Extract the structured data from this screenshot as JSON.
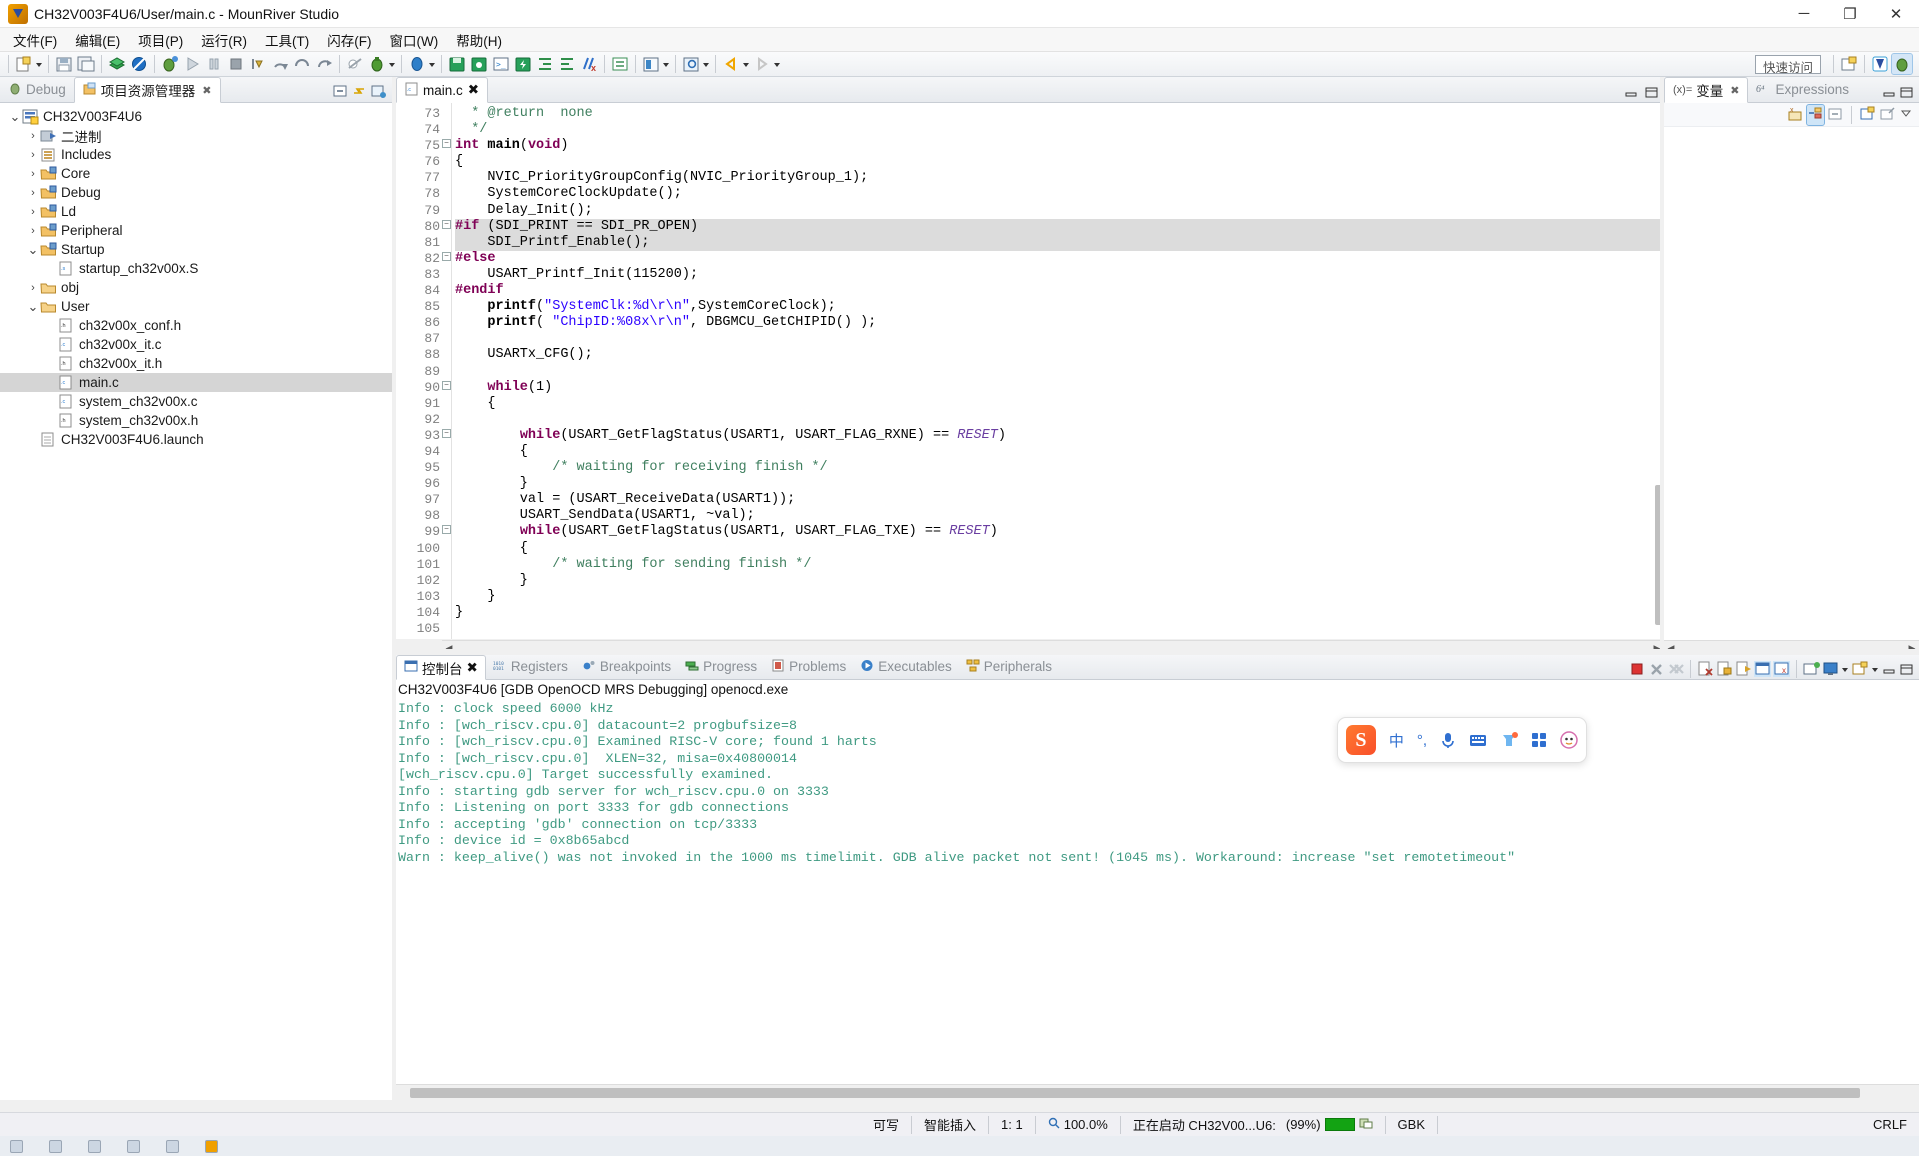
{
  "window": {
    "title": "CH32V003F4U6/User/main.c - MounRiver Studio",
    "app_icon": "mounriver-logo-icon",
    "minimize": "─",
    "maximize": "❐",
    "close": "✕"
  },
  "menubar": {
    "items": [
      {
        "label": "文件(F)",
        "name": "menu-file"
      },
      {
        "label": "编辑(E)",
        "name": "menu-edit"
      },
      {
        "label": "项目(P)",
        "name": "menu-project"
      },
      {
        "label": "运行(R)",
        "name": "menu-run"
      },
      {
        "label": "工具(T)",
        "name": "menu-tools"
      },
      {
        "label": "闪存(F)",
        "name": "menu-flash"
      },
      {
        "label": "窗口(W)",
        "name": "menu-window"
      },
      {
        "label": "帮助(H)",
        "name": "menu-help"
      }
    ]
  },
  "toolbar": {
    "quick_access": "快速访问",
    "perspective_icons": [
      "new-perspective-icon",
      "mounriver-perspective-icon",
      "debug-perspective-icon"
    ]
  },
  "left_panel": {
    "tabs": [
      {
        "label": "Debug",
        "name": "view-tab-debug",
        "active": false,
        "icon": "bug-icon"
      },
      {
        "label": "项目资源管理器",
        "name": "view-tab-project-explorer",
        "active": true,
        "icon": "project-explorer-icon",
        "close": "✖"
      }
    ],
    "toolbar_icons": [
      "collapse-all-icon",
      "link-with-editor-icon",
      "view-menu-icon"
    ],
    "tree": [
      {
        "label": "CH32V003F4U6",
        "indent": 0,
        "twist": "v",
        "icon": "project-icon",
        "selected": false
      },
      {
        "label": "二进制",
        "indent": 1,
        "twist": ">",
        "icon": "binaries-icon",
        "selected": false
      },
      {
        "label": "Includes",
        "indent": 1,
        "twist": ">",
        "icon": "includes-icon",
        "selected": false
      },
      {
        "label": "Core",
        "indent": 1,
        "twist": ">",
        "icon": "source-folder-icon",
        "selected": false
      },
      {
        "label": "Debug",
        "indent": 1,
        "twist": ">",
        "icon": "source-folder-icon",
        "selected": false
      },
      {
        "label": "Ld",
        "indent": 1,
        "twist": ">",
        "icon": "source-folder-icon",
        "selected": false
      },
      {
        "label": "Peripheral",
        "indent": 1,
        "twist": ">",
        "icon": "source-folder-icon",
        "selected": false
      },
      {
        "label": "Startup",
        "indent": 1,
        "twist": "v",
        "icon": "source-folder-icon",
        "selected": false
      },
      {
        "label": "startup_ch32v00x.S",
        "indent": 2,
        "twist": "",
        "icon": "asm-file-icon",
        "tag": ".s",
        "selected": false
      },
      {
        "label": "obj",
        "indent": 1,
        "twist": ">",
        "icon": "folder-icon",
        "selected": false
      },
      {
        "label": "User",
        "indent": 1,
        "twist": "v",
        "icon": "folder-icon",
        "selected": false
      },
      {
        "label": "ch32v00x_conf.h",
        "indent": 2,
        "twist": "",
        "icon": "header-file-icon",
        "tag": ".h",
        "selected": false
      },
      {
        "label": "ch32v00x_it.c",
        "indent": 2,
        "twist": "",
        "icon": "c-file-icon",
        "tag": ".c",
        "selected": false
      },
      {
        "label": "ch32v00x_it.h",
        "indent": 2,
        "twist": "",
        "icon": "header-file-icon",
        "tag": ".h",
        "selected": false
      },
      {
        "label": "main.c",
        "indent": 2,
        "twist": "",
        "icon": "c-file-icon",
        "tag": ".c",
        "selected": true
      },
      {
        "label": "system_ch32v00x.c",
        "indent": 2,
        "twist": "",
        "icon": "c-file-icon",
        "tag": ".c",
        "selected": false
      },
      {
        "label": "system_ch32v00x.h",
        "indent": 2,
        "twist": "",
        "icon": "header-file-icon",
        "tag": ".h",
        "selected": false
      },
      {
        "label": "CH32V003F4U6.launch",
        "indent": 1,
        "twist": "",
        "icon": "launch-file-icon",
        "selected": false
      }
    ]
  },
  "editor": {
    "tab": {
      "label": "main.c",
      "icon": "c-file-icon",
      "close": "✖"
    },
    "toolbar_icons": [
      "minimize-icon",
      "maximize-icon"
    ],
    "first_line": 73,
    "lines": [
      {
        "n": 73,
        "fold": "",
        "html": "  <span class=\"cm\">* @return  none</span>"
      },
      {
        "n": 74,
        "fold": "",
        "html": "  <span class=\"cm\">*/</span>"
      },
      {
        "n": 75,
        "fold": "-",
        "html": "<span class=\"kw\">int</span> <span class=\"fn\" style=\"font-weight:bold\">main</span>(<span class=\"kw\">void</span>)"
      },
      {
        "n": 76,
        "fold": "",
        "html": "{"
      },
      {
        "n": 77,
        "fold": "",
        "html": "    NVIC_PriorityGroupConfig(NVIC_PriorityGroup_1);"
      },
      {
        "n": 78,
        "fold": "",
        "html": "    SystemCoreClockUpdate();"
      },
      {
        "n": 79,
        "fold": "",
        "html": "    Delay_Init();"
      },
      {
        "n": 80,
        "fold": "-",
        "hl": true,
        "html": "<span class=\"pp\">#if</span> (SDI_PRINT == SDI_PR_OPEN)"
      },
      {
        "n": 81,
        "fold": "",
        "hl": true,
        "html": "    SDI_Printf_Enable();"
      },
      {
        "n": 82,
        "fold": "-",
        "html": "<span class=\"pp\">#else</span>"
      },
      {
        "n": 83,
        "fold": "",
        "html": "    USART_Printf_Init(115200);"
      },
      {
        "n": 84,
        "fold": "",
        "html": "<span class=\"pp\">#endif</span>"
      },
      {
        "n": 85,
        "fold": "",
        "html": "    <span style=\"font-weight:bold\">printf</span>(<span class=\"st\">\"SystemClk:%d\\r\\n\"</span>,SystemCoreClock);"
      },
      {
        "n": 86,
        "fold": "",
        "html": "    <span style=\"font-weight:bold\">printf</span>( <span class=\"st\">\"ChipID:%08x\\r\\n\"</span>, DBGMCU_GetCHIPID() );"
      },
      {
        "n": 87,
        "fold": "",
        "html": ""
      },
      {
        "n": 88,
        "fold": "",
        "html": "    USARTx_CFG();"
      },
      {
        "n": 89,
        "fold": "",
        "html": ""
      },
      {
        "n": 90,
        "fold": "-",
        "html": "    <span class=\"kw\">while</span>(1)"
      },
      {
        "n": 91,
        "fold": "",
        "html": "    {"
      },
      {
        "n": 92,
        "fold": "",
        "html": ""
      },
      {
        "n": 93,
        "fold": "-",
        "html": "        <span class=\"kw\">while</span>(USART_GetFlagStatus(USART1, USART_FLAG_RXNE) == <span class=\"it\">RESET</span>)"
      },
      {
        "n": 94,
        "fold": "",
        "html": "        {"
      },
      {
        "n": 95,
        "fold": "",
        "html": "            <span class=\"cm\">/* waiting for receiving finish */</span>"
      },
      {
        "n": 96,
        "fold": "",
        "html": "        }"
      },
      {
        "n": 97,
        "fold": "",
        "html": "        val = (USART_ReceiveData(USART1));"
      },
      {
        "n": 98,
        "fold": "",
        "html": "        USART_SendData(USART1, ~val);"
      },
      {
        "n": 99,
        "fold": "-",
        "html": "        <span class=\"kw\">while</span>(USART_GetFlagStatus(USART1, USART_FLAG_TXE) == <span class=\"it\">RESET</span>)"
      },
      {
        "n": 100,
        "fold": "",
        "html": "        {"
      },
      {
        "n": 101,
        "fold": "",
        "html": "            <span class=\"cm\">/* waiting for sending finish */</span>"
      },
      {
        "n": 102,
        "fold": "",
        "html": "        }"
      },
      {
        "n": 103,
        "fold": "",
        "html": "    }"
      },
      {
        "n": 104,
        "fold": "",
        "html": "}"
      },
      {
        "n": 105,
        "fold": "",
        "html": ""
      }
    ]
  },
  "right_panel": {
    "tabs": [
      {
        "label": "变量",
        "name": "view-tab-variables",
        "active": true,
        "icon": "variables-icon",
        "close": "✖"
      },
      {
        "label": "Expressions",
        "name": "view-tab-expressions",
        "active": false,
        "icon": "expressions-icon"
      }
    ],
    "toolbar_icons": [
      "show-type-names-icon",
      "show-logical-structure-icon",
      "collapse-all-icon",
      "new-expression-icon",
      "edit-watch-icon",
      "view-menu-icon"
    ]
  },
  "ime": {
    "name": "sogou-input-method-toolbar",
    "logo": "S",
    "buttons": [
      {
        "label": "中",
        "name": "ime-chinese-mode-icon"
      },
      {
        "label": "°,",
        "name": "ime-punctuation-icon"
      },
      {
        "label": "",
        "name": "ime-microphone-icon"
      },
      {
        "label": "",
        "name": "ime-keyboard-icon"
      },
      {
        "label": "",
        "name": "ime-skin-icon"
      },
      {
        "label": "",
        "name": "ime-toolbox-icon"
      },
      {
        "label": "",
        "name": "ime-mascot-icon"
      }
    ]
  },
  "console": {
    "tabs": [
      {
        "label": "控制台",
        "name": "tab-console",
        "active": true,
        "icon": "console-icon",
        "close": "✖"
      },
      {
        "label": "Registers",
        "name": "tab-registers",
        "active": false,
        "icon": "registers-icon"
      },
      {
        "label": "Breakpoints",
        "name": "tab-breakpoints",
        "active": false,
        "icon": "breakpoints-icon"
      },
      {
        "label": "Progress",
        "name": "tab-progress",
        "active": false,
        "icon": "progress-icon"
      },
      {
        "label": "Problems",
        "name": "tab-problems",
        "active": false,
        "icon": "problems-icon"
      },
      {
        "label": "Executables",
        "name": "tab-executables",
        "active": false,
        "icon": "executables-icon"
      },
      {
        "label": "Peripherals",
        "name": "tab-peripherals",
        "active": false,
        "icon": "peripherals-icon"
      }
    ],
    "header": "CH32V003F4U6 [GDB OpenOCD MRS Debugging] openocd.exe",
    "log": [
      "Info : clock speed 6000 kHz",
      "Info : [wch_riscv.cpu.0] datacount=2 progbufsize=8",
      "Info : [wch_riscv.cpu.0] Examined RISC-V core; found 1 harts",
      "Info : [wch_riscv.cpu.0]  XLEN=32, misa=0x40800014",
      "[wch_riscv.cpu.0] Target successfully examined.",
      "Info : starting gdb server for wch_riscv.cpu.0 on 3333",
      "Info : Listening on port 3333 for gdb connections",
      "Info : accepting 'gdb' connection on tcp/3333",
      "Info : device id = 0x8b65abcd",
      "Warn : keep_alive() was not invoked in the 1000 ms timelimit. GDB alive packet not sent! (1045 ms). Workaround: increase \"set remotetimeout\""
    ],
    "toolbar_icons": [
      "terminate-icon",
      "remove-launch-icon",
      "remove-all-terminated-icon",
      "clear-console-icon",
      "scroll-lock-icon",
      "show-console-on-output-icon",
      "pin-console-icon",
      "display-selected-console-icon",
      "open-console-icon",
      "minimize-icon",
      "maximize-icon"
    ]
  },
  "statusbar": {
    "writable": "可写",
    "insert_mode": "智能插入",
    "cursor_position": "1: 1",
    "zoom": "100.0%",
    "zoom_icon": "zoom-icon",
    "progress_text": "正在启动 CH32V00...U6:",
    "progress_percent": "(99%)",
    "encoding": "GBK",
    "line_ending": "CRLF"
  }
}
